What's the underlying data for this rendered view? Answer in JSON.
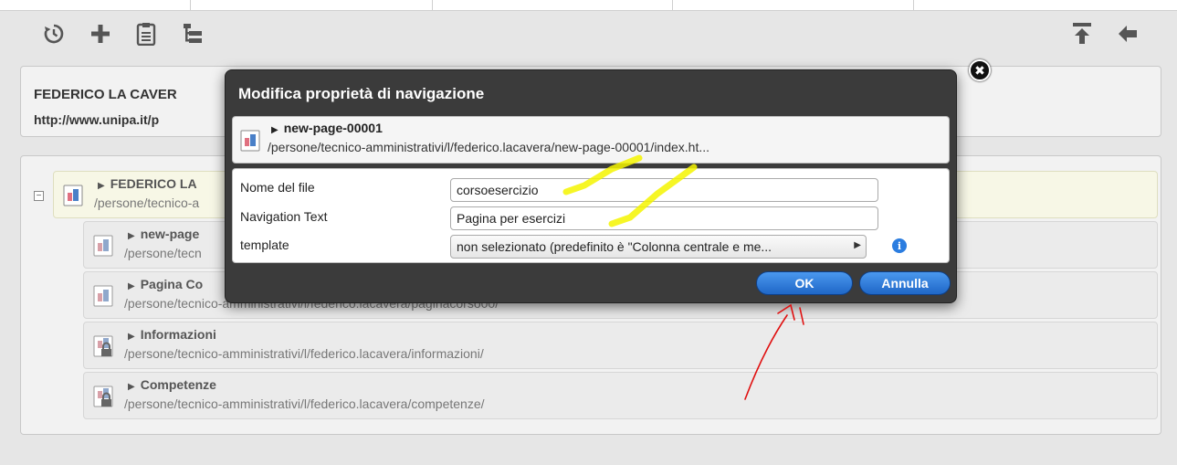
{
  "toolbar": {
    "left_icons": [
      "history-icon",
      "add-icon",
      "clipboard-icon",
      "tree-icon"
    ],
    "right_icons": [
      "move-top-icon",
      "back-arrow-icon"
    ]
  },
  "header": {
    "title": "FEDERICO LA CAVER",
    "url": "http://www.unipa.it/p"
  },
  "tree": {
    "collapse_symbol": "⊟",
    "root": {
      "name": "FEDERICO LA",
      "path": "/persone/tecnico-a"
    },
    "children": [
      {
        "name": "new-page",
        "path": "/persone/tecn",
        "locked": false
      },
      {
        "name": "Pagina Co",
        "path": "/persone/tecnico-amministrativi/l/federico.lacavera/paginacorso00/",
        "locked": false
      },
      {
        "name": "Informazioni",
        "path": "/persone/tecnico-amministrativi/l/federico.lacavera/informazioni/",
        "locked": true
      },
      {
        "name": "Competenze",
        "path": "/persone/tecnico-amministrativi/l/federico.lacavera/competenze/",
        "locked": true
      }
    ]
  },
  "modal": {
    "title": "Modifica proprietà di navigazione",
    "close_icon": "close-icon",
    "page": {
      "name": "new-page-00001",
      "path": "/persone/tecnico-amministrativi/l/federico.lacavera/new-page-00001/index.ht..."
    },
    "fields": {
      "filename_label": "Nome del file",
      "filename_value": "corsoesercizio",
      "navtext_label": "Navigation Text",
      "navtext_value": "Pagina per esercizi",
      "template_label": "template",
      "template_value": "non selezionato (predefinito è \"Colonna centrale e me..."
    },
    "ok_label": "OK",
    "cancel_label": "Annulla"
  },
  "colors": {
    "modal_bg": "#3b3b3b",
    "button_blue": "#1f67c7",
    "highlight_yellow": "#f5f500",
    "annotation_red": "#e01010"
  }
}
